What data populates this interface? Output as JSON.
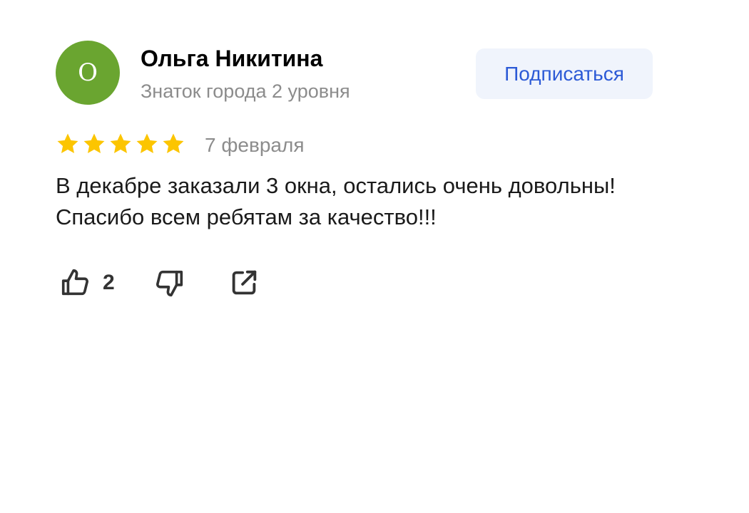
{
  "author": {
    "avatar_letter": "О",
    "avatar_color": "#6aa530",
    "name": "Ольга Никитина",
    "level": "Знаток города 2 уровня"
  },
  "subscribe": {
    "label": "Подписаться",
    "text_color": "#2c5ad6",
    "background": "#f0f4fc"
  },
  "rating": {
    "stars": 5,
    "max": 5,
    "color": "#fcc500",
    "icon": "star-icon"
  },
  "date": "7 февраля",
  "text": "В декабре заказали 3 окна, остались очень довольны! Спасибо всем ребятам за качество!!!",
  "actions": {
    "like": {
      "icon": "thumbs-up-icon",
      "count": "2"
    },
    "dislike": {
      "icon": "thumbs-down-icon"
    },
    "share": {
      "icon": "share-icon"
    }
  }
}
